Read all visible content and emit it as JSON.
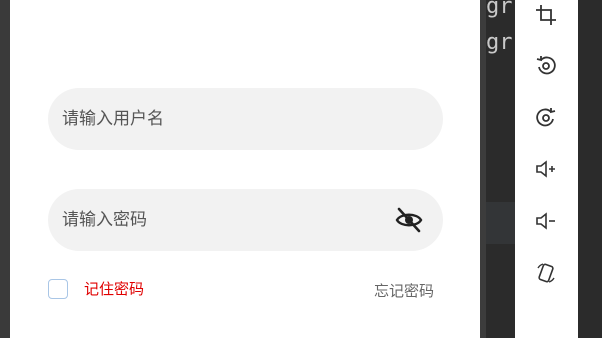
{
  "login": {
    "username_placeholder": "请输入用户名",
    "password_placeholder": "请输入密码",
    "remember_label": "记住密码",
    "forgot_label": "忘记密码",
    "colors": {
      "remember": "#e00000",
      "field_bg": "#f2f2f2",
      "checkbox_border": "#a9c6e6"
    }
  },
  "password_toggle_icon": "eye-slash-icon",
  "ide_code": {
    "line1": "gr  er",
    "line2": "gr  er"
  },
  "emulator_toolbar": {
    "buttons": [
      {
        "icon": "crop-icon"
      },
      {
        "icon": "rotate-left-icon"
      },
      {
        "icon": "rotate-right-icon"
      },
      {
        "icon": "volume-up-icon"
      },
      {
        "icon": "volume-down-icon"
      },
      {
        "icon": "device-rotate-icon"
      }
    ]
  }
}
